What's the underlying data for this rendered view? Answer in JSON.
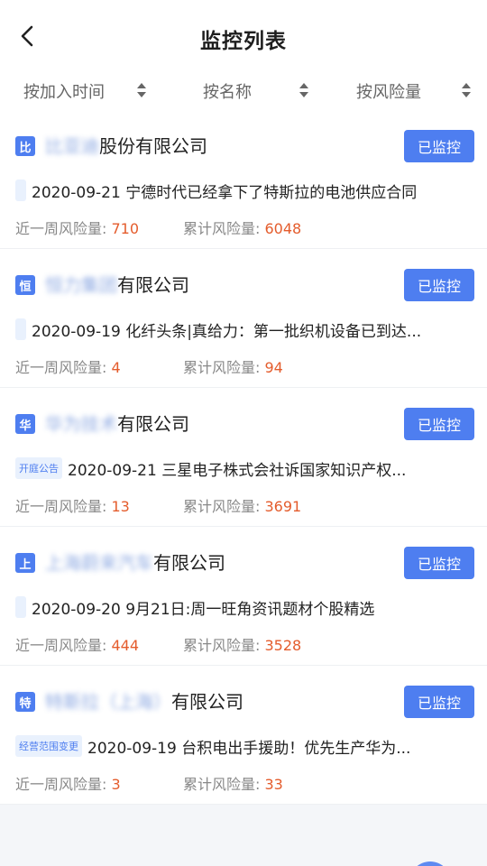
{
  "header": {
    "title": "监控列表"
  },
  "sort": {
    "by_time": "按加入时间",
    "by_name": "按名称",
    "by_risk": "按风险量"
  },
  "labels": {
    "monitor_btn": "已监控",
    "week_risk": "近一周风险量: ",
    "total_risk": "累计风险量: "
  },
  "companies": [
    {
      "logo": "比",
      "name_blurred": "比亚迪",
      "name_suffix": "股份有限公司",
      "tag": "",
      "news": "2020-09-21 宁德时代已经拿下了特斯拉的电池供应合同",
      "week_risk": "710",
      "total_risk": "6048"
    },
    {
      "logo": "恒",
      "name_blurred": "恒力集团",
      "name_suffix": "有限公司",
      "tag": "",
      "news": "2020-09-19 化纤头条|真给力：第一批织机设备已到达...",
      "week_risk": "4",
      "total_risk": "94"
    },
    {
      "logo": "华",
      "name_blurred": "华为技术",
      "name_suffix": "有限公司",
      "tag": "开庭公告",
      "news": "2020-09-21 三星电子株式会社诉国家知识产权...",
      "week_risk": "13",
      "total_risk": "3691"
    },
    {
      "logo": "上",
      "name_blurred": "上海蔚来汽车",
      "name_suffix": "有限公司",
      "tag": "",
      "news": "2020-09-20 9月21日:周一旺角资讯题材个股精选",
      "week_risk": "444",
      "total_risk": "3528"
    },
    {
      "logo": "特",
      "name_blurred": "特斯拉（上海）",
      "name_suffix": "有限公司",
      "tag": "经营范围变更",
      "news": "2020-09-19 台积电出手援助！优先生产华为...",
      "week_risk": "3",
      "total_risk": "33"
    }
  ]
}
